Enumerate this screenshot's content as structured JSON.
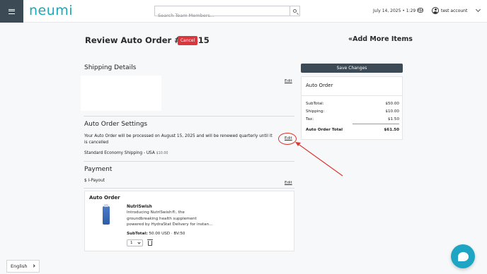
{
  "header": {
    "logo": "neumi",
    "search_placeholder": "Search Team Members...",
    "datetime": "July 14, 2025 • 1:29 PM",
    "account": "test account"
  },
  "page": {
    "title": "Review Auto Order #71415",
    "cancel_label": "Cancel",
    "add_more_label": "Add More Items"
  },
  "shipping": {
    "title": "Shipping Details",
    "edit_label": "Edit"
  },
  "settings": {
    "title": "Auto Order Settings",
    "description": "Your Auto Order will be processed on August 15, 2025 and will be renewed quarterly until it is cancelled",
    "edit_label": "Edit",
    "shipping_method": "Standard Economy Shipping - USA",
    "shipping_price": "$10.00"
  },
  "payment": {
    "title": "Payment",
    "method": "$ I-Payout",
    "edit_label": "Edit"
  },
  "order_card": {
    "title": "Auto Order",
    "product_name": "NutriSwish",
    "product_desc": "Introducing NutriSwish®, the groundbreaking health supplement powered by HydraStat Delivery for instan...",
    "subtotal_label": "SubTotal:",
    "subtotal_value": "50.00 USD · BV:50",
    "quantity": "1"
  },
  "summary": {
    "save_label": "Save Changes",
    "title": "Auto Order",
    "rows": [
      {
        "label": "SubTotal:",
        "value": "$50.00"
      },
      {
        "label": "Shipping:",
        "value": "$10.00"
      },
      {
        "label": "Tax:",
        "value": "$1.50"
      }
    ],
    "total_label": "Auto Order Total",
    "total_value": "$61.50"
  },
  "footer": {
    "language": "English"
  },
  "colors": {
    "brand": "#19a9b8",
    "danger": "#d9363e",
    "dark": "#3c4a55",
    "annotation": "#d93a32",
    "chat": "#1fa5c4"
  }
}
